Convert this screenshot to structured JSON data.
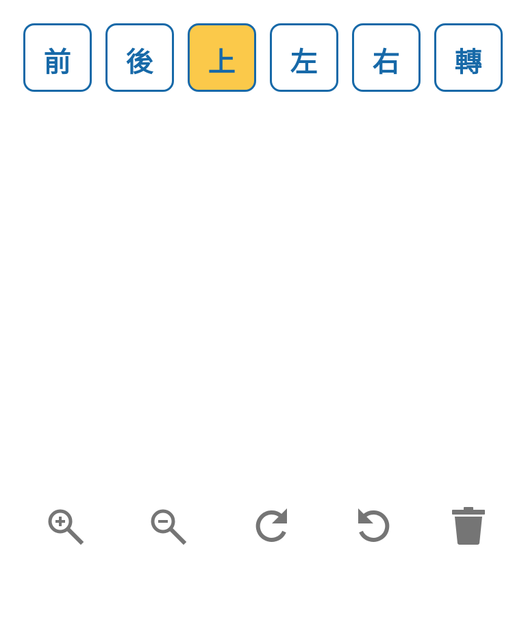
{
  "view_buttons": [
    {
      "label": "前",
      "active": false
    },
    {
      "label": "後",
      "active": false
    },
    {
      "label": "上",
      "active": true
    },
    {
      "label": "左",
      "active": false
    },
    {
      "label": "右",
      "active": false
    },
    {
      "label": "轉",
      "active": false
    }
  ],
  "colors": {
    "border": "#1769a8",
    "text": "#1769a8",
    "active_fill": "#fbc94a",
    "icon": "#757575"
  },
  "tools": [
    {
      "icon": "zoom-in-icon"
    },
    {
      "icon": "zoom-out-icon"
    },
    {
      "icon": "rotate-clockwise-icon"
    },
    {
      "icon": "rotate-counterclockwise-icon"
    },
    {
      "icon": "trash-icon"
    }
  ]
}
